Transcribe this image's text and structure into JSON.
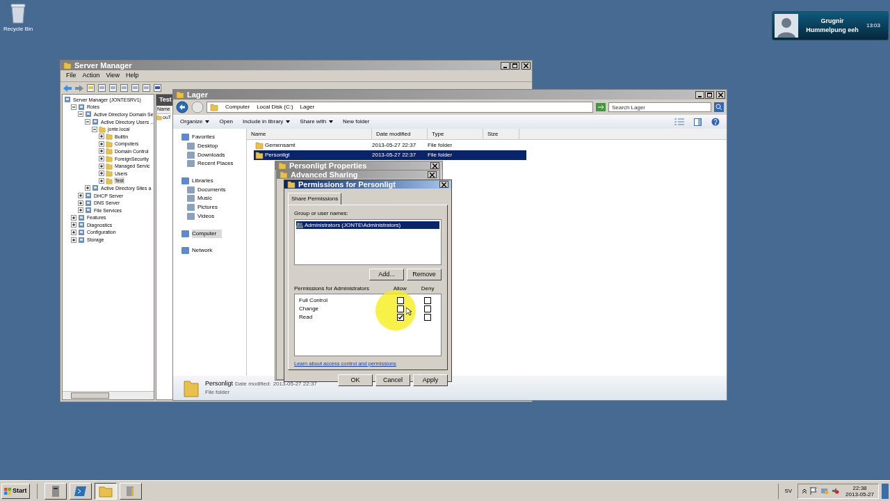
{
  "desktop_icons": [
    {
      "label": "Recycle Bin"
    }
  ],
  "notification": {
    "title": "Grugnir",
    "message": "Hummelpung eeh",
    "time": "13:03"
  },
  "server_manager": {
    "title": "Server Manager",
    "menu": [
      "File",
      "Action",
      "View",
      "Help"
    ],
    "tree": [
      {
        "label": "Server Manager (JONTESRV1)",
        "selected": false,
        "children": [
          {
            "label": "Roles",
            "selected": false,
            "expanded": true,
            "children": [
              {
                "label": "Active Directory Domain Se",
                "selected": false,
                "expanded": true,
                "children": [
                  {
                    "label": "Active Directory Users ...",
                    "selected": false,
                    "expanded": true,
                    "children": [
                      {
                        "label": "jonte.local",
                        "selected": false,
                        "expanded": true,
                        "children": [
                          {
                            "label": "Builtin",
                            "selected": false,
                            "expanded": false
                          },
                          {
                            "label": "Computers",
                            "selected": false,
                            "expanded": false
                          },
                          {
                            "label": "Domain Control",
                            "selected": false,
                            "expanded": false
                          },
                          {
                            "label": "ForeignSecurity",
                            "selected": false,
                            "expanded": false
                          },
                          {
                            "label": "Managed Servic",
                            "selected": false,
                            "expanded": false
                          },
                          {
                            "label": "Users",
                            "selected": false,
                            "expanded": false
                          },
                          {
                            "label": "Test",
                            "selected": true,
                            "expanded": false
                          }
                        ]
                      }
                    ]
                  },
                  {
                    "label": "Active Directory Sites a",
                    "selected": false,
                    "expanded": false
                  }
                ]
              },
              {
                "label": "DHCP Server",
                "selected": false,
                "expanded": false
              },
              {
                "label": "DNS Server",
                "selected": false,
                "expanded": false
              },
              {
                "label": "File Services",
                "selected": false,
                "expanded": false
              }
            ]
          },
          {
            "label": "Features",
            "selected": false,
            "expanded": false
          },
          {
            "label": "Diagnostics",
            "selected": false,
            "expanded": false
          },
          {
            "label": "Configuration",
            "selected": false,
            "expanded": false
          },
          {
            "label": "Storage",
            "selected": false,
            "expanded": false
          }
        ]
      }
    ],
    "middle_pane": {
      "title": "Test",
      "column": "Name",
      "item": "ouT"
    }
  },
  "explorer": {
    "title": "Lager",
    "breadcrumb": [
      "Computer",
      "Local Disk (C:)",
      "Lager"
    ],
    "search": {
      "placeholder": "Search Lager"
    },
    "toolbar": [
      {
        "label": "Organize",
        "dropdown": true
      },
      {
        "label": "Open",
        "dropdown": false
      },
      {
        "label": "Include in library",
        "dropdown": true
      },
      {
        "label": "Share with",
        "dropdown": true
      },
      {
        "label": "New folder",
        "dropdown": false
      }
    ],
    "nav": [
      {
        "label": "Favorites",
        "kind": "group",
        "selected": false
      },
      {
        "label": "Desktop",
        "kind": "item",
        "selected": false
      },
      {
        "label": "Downloads",
        "kind": "item",
        "selected": false
      },
      {
        "label": "Recent Places",
        "kind": "item",
        "selected": false
      },
      {
        "label": "Libraries",
        "kind": "group",
        "selected": false
      },
      {
        "label": "Documents",
        "kind": "item",
        "selected": false
      },
      {
        "label": "Music",
        "kind": "item",
        "selected": false
      },
      {
        "label": "Pictures",
        "kind": "item",
        "selected": false
      },
      {
        "label": "Videos",
        "kind": "item",
        "selected": false
      },
      {
        "label": "Computer",
        "kind": "group",
        "selected": true
      },
      {
        "label": "Network",
        "kind": "group",
        "selected": false
      }
    ],
    "columns": [
      "Name",
      "Date modified",
      "Type",
      "Size"
    ],
    "rows": [
      {
        "name": "Gemensamt",
        "date": "2013-05-27 22:37",
        "type": "File folder",
        "selected": false
      },
      {
        "name": "Personligt",
        "date": "2013-05-27 22:37",
        "type": "File folder",
        "selected": true
      }
    ],
    "details": {
      "name": "Personligt",
      "date_label": "Date modified:",
      "date": "2013-05-27 22:37",
      "type": "File folder"
    }
  },
  "properties_dialog": {
    "title": "Personligt Properties"
  },
  "advanced_sharing_dialog": {
    "title": "Advanced Sharing"
  },
  "permissions_dialog": {
    "title": "Permissions for Personligt",
    "tab": "Share Permissions",
    "group_label": "Group or user names:",
    "users": [
      {
        "label": "Administrators (JONTE\\Administrators)",
        "selected": true
      }
    ],
    "user_buttons": [
      "Add...",
      "Remove"
    ],
    "permissions_label": "Permissions for Administrators",
    "allow_label": "Allow",
    "deny_label": "Deny",
    "permissions": [
      {
        "name": "Full Control",
        "allow": false,
        "deny": false
      },
      {
        "name": "Change",
        "allow": false,
        "deny": false
      },
      {
        "name": "Read",
        "allow": true,
        "deny": false
      }
    ],
    "link": "Learn about access control and permissions",
    "buttons": [
      "OK",
      "Cancel",
      "Apply"
    ]
  },
  "taskbar": {
    "start": "Start",
    "apps": [
      {
        "kind": "server",
        "selected": false
      },
      {
        "kind": "powershell",
        "selected": false
      },
      {
        "kind": "explorer",
        "selected": true
      },
      {
        "kind": "tools",
        "selected": false
      }
    ],
    "language": "SV",
    "time": "22:38",
    "date": "2013-05-27"
  }
}
